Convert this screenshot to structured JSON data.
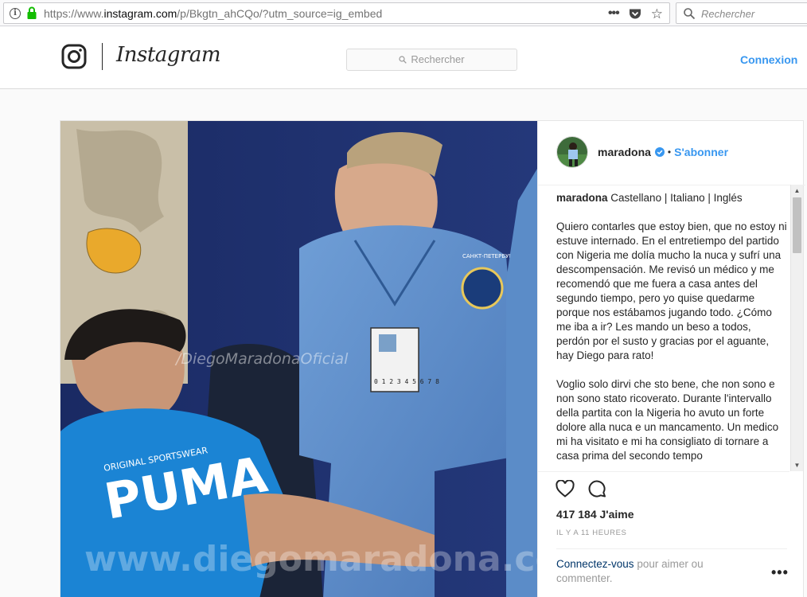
{
  "browser": {
    "url_prefix": "https://www.",
    "url_domain": "instagram.com",
    "url_path": "/p/Bkgtn_ahCQo/?utm_source=ig_embed",
    "search_placeholder": "Rechercher",
    "info_glyph": "i"
  },
  "header": {
    "brand": "Instagram",
    "search_placeholder": "Rechercher",
    "login_label": "Connexion"
  },
  "photo": {
    "watermark_facebook": "/DiegoMaradonaOficial",
    "watermark_bottom": "www.diegomaradona.com",
    "shirt_small": "ORIGINAL SPORTSWEAR",
    "shirt_big": "PUMA",
    "badge_text": "САНКТ-ПЕТЕРБУРГ",
    "id_card_numbers": "0 1 2 3 4 5 6 7 8"
  },
  "post": {
    "username": "maradona",
    "separator": "•",
    "follow_label": "S'abonner",
    "caption_user": "maradona",
    "caption_head": " Castellano | Italiano | Inglés",
    "caption_p1": "Quiero contarles que estoy bien, que no estoy ni estuve internado. En el entretiempo del partido con Nigeria me dolía mucho la nuca y sufrí una descompensación. Me revisó un médico y me recomendó que me fuera a casa antes del segundo tiempo, pero yo quise quedarme porque nos estábamos jugando todo. ¿Cómo me iba a ir? Les mando un beso a todos, perdón por el susto y gracias por el aguante, hay Diego para rato!",
    "caption_p2": "Voglio solo dirvi che sto bene, che non sono e non sono stato ricoverato. Durante l'intervallo della partita con la Nigeria ho avuto un forte dolore alla nuca e un mancamento. Un medico mi ha visitato e mi ha consigliato di tornare a casa prima del secondo tempo",
    "likes": "417 184 J'aime",
    "time": "IL Y A 11 HEURES",
    "login_link": "Connectez-vous",
    "login_rest": " pour aimer ou commenter.",
    "more_glyph": "•••"
  },
  "colors": {
    "link": "#3897f0",
    "text": "#262626",
    "muted": "#999999"
  }
}
